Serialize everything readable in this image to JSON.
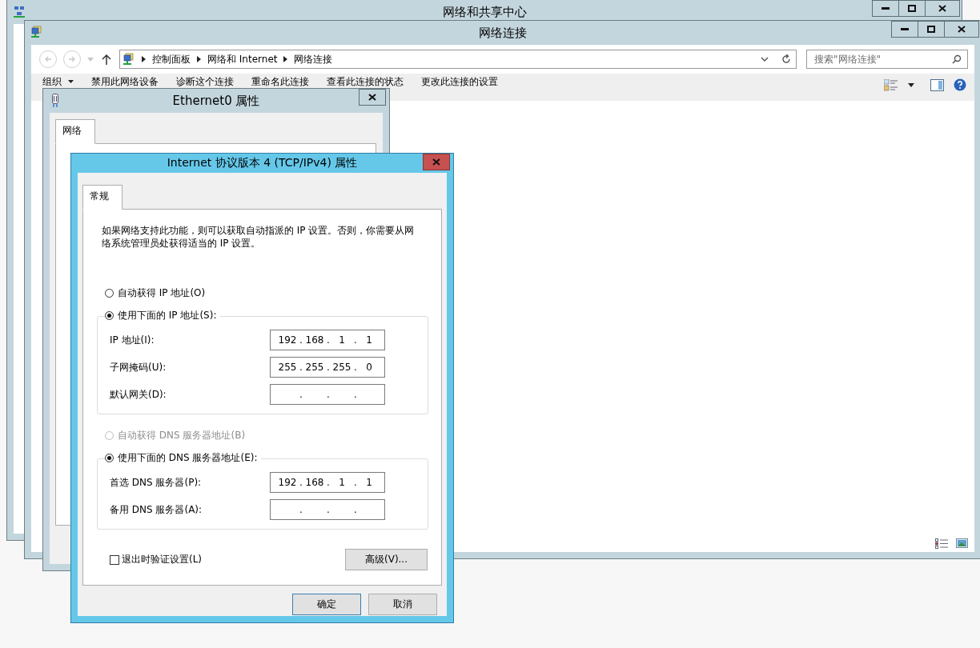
{
  "background_window": {
    "title": "网络和共享中心"
  },
  "explorer": {
    "title": "网络连接",
    "breadcrumb": [
      "控制面板",
      "网络和 Internet",
      "网络连接"
    ],
    "search": {
      "placeholder": "搜索\"网络连接\""
    },
    "toolbar": [
      {
        "label": "组织",
        "kind": "menu"
      },
      {
        "label": "禁用此网络设备",
        "kind": "command"
      },
      {
        "label": "诊断这个连接",
        "kind": "command"
      },
      {
        "label": "重命名此连接",
        "kind": "command"
      },
      {
        "label": "查看此连接的状态",
        "kind": "command"
      },
      {
        "label": "更改此连接的设置",
        "kind": "command"
      }
    ]
  },
  "ethernet_dialog": {
    "title": "Ethernet0 属性",
    "tabs": [
      {
        "label": "网络",
        "selected": true
      }
    ]
  },
  "ipv4_dialog": {
    "title": "Internet 协议版本 4 (TCP/IPv4) 属性",
    "tabs": [
      {
        "label": "常规",
        "selected": true
      }
    ],
    "description": "如果网络支持此功能，则可以获取自动指派的 IP 设置。否则，你需要从网络系统管理员处获得适当的 IP 设置。",
    "ip_options": [
      {
        "label": "自动获得 IP 地址(O)",
        "selected": false,
        "disabled": false
      },
      {
        "label": "使用下面的 IP 地址(S):",
        "selected": true,
        "disabled": false
      }
    ],
    "ip_fields": [
      {
        "label": "IP 地址(I):",
        "parts": [
          "192",
          ".",
          "168",
          ".",
          "1",
          ".",
          "1"
        ]
      },
      {
        "label": "子网掩码(U):",
        "parts": [
          "255",
          ".",
          "255",
          ".",
          "255",
          ".",
          "0"
        ]
      },
      {
        "label": "默认网关(D):",
        "parts": [
          ".",
          ".",
          "."
        ]
      }
    ],
    "dns_options": [
      {
        "label": "自动获得 DNS 服务器地址(B)",
        "selected": false,
        "disabled": true
      },
      {
        "label": "使用下面的 DNS 服务器地址(E):",
        "selected": true,
        "disabled": false
      }
    ],
    "dns_fields": [
      {
        "label": "首选 DNS 服务器(P):",
        "parts": [
          "192",
          ".",
          "168",
          ".",
          "1",
          ".",
          "1"
        ]
      },
      {
        "label": "备用 DNS 服务器(A):",
        "parts": [
          ".",
          ".",
          "."
        ]
      }
    ],
    "validate": {
      "label": "退出时验证设置(L)",
      "checked": false
    },
    "advanced_button": "高级(V)...",
    "buttons": [
      "确定",
      "取消"
    ]
  }
}
